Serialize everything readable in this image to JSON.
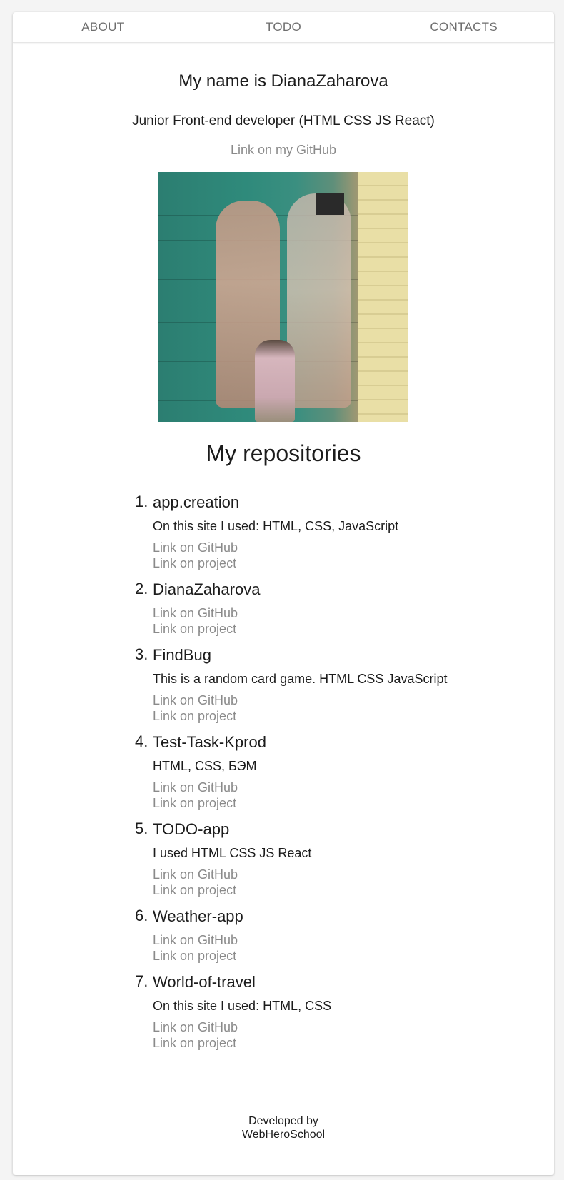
{
  "nav": {
    "items": [
      "ABOUT",
      "TODO",
      "CONTACTS"
    ]
  },
  "hero": {
    "title": "My name is DianaZaharova",
    "subtitle": "Junior Front-end developer (HTML CSS JS React)",
    "github_link": "Link on my GitHub"
  },
  "repos_title": "My repositories",
  "repos": [
    {
      "num": "1.",
      "name": "app.creation",
      "desc": "On this site I used: HTML, CSS, JavaScript",
      "github": "Link on GitHub",
      "project": "Link on project"
    },
    {
      "num": "2.",
      "name": "DianaZaharova",
      "desc": "",
      "github": "Link on GitHub",
      "project": "Link on project"
    },
    {
      "num": "3.",
      "name": "FindBug",
      "desc": "This is a random card game. HTML CSS JavaScript",
      "github": "Link on GitHub",
      "project": "Link on project"
    },
    {
      "num": "4.",
      "name": "Test-Task-Kprod",
      "desc": "HTML, CSS, БЭМ",
      "github": "Link on GitHub",
      "project": "Link on project"
    },
    {
      "num": "5.",
      "name": "TODO-app",
      "desc": "I used HTML CSS JS React",
      "github": "Link on GitHub",
      "project": "Link on project"
    },
    {
      "num": "6.",
      "name": "Weather-app",
      "desc": "",
      "github": "Link on GitHub",
      "project": "Link on project"
    },
    {
      "num": "7.",
      "name": "World-of-travel",
      "desc": "On this site I used: HTML, CSS",
      "github": "Link on GitHub",
      "project": "Link on project"
    }
  ],
  "footer": {
    "line1": "Developed by",
    "line2": "WebHeroSchool"
  }
}
